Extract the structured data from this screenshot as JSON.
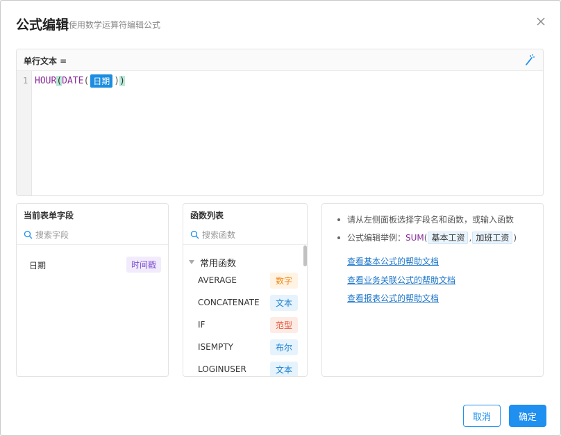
{
  "dialog": {
    "title": "公式编辑",
    "subtitle": "使用数学运算符编辑公式"
  },
  "editor": {
    "label": "单行文本 =",
    "line_number": "1",
    "tokens": {
      "fn1": "HOUR",
      "open1": "(",
      "fn2": "DATE",
      "open2": "(",
      "field": "日期",
      "close2": ")",
      "close1": ")"
    }
  },
  "fields_panel": {
    "title": "当前表单字段",
    "search_placeholder": "搜索字段",
    "items": [
      {
        "name": "日期",
        "type": "时间戳",
        "type_color": "#7b4fd3",
        "type_bg": "#f1ebfc"
      }
    ]
  },
  "functions_panel": {
    "title": "函数列表",
    "search_placeholder": "搜索函数",
    "group": "常用函数",
    "items": [
      {
        "name": "AVERAGE",
        "type": "数字",
        "color": "#f08a1c",
        "bg": "#fff3e4"
      },
      {
        "name": "CONCATENATE",
        "type": "文本",
        "color": "#1a7fd0",
        "bg": "#e6f3fc"
      },
      {
        "name": "IF",
        "type": "范型",
        "color": "#e8593a",
        "bg": "#fdebe6"
      },
      {
        "name": "ISEMPTY",
        "type": "布尔",
        "color": "#1a7fd0",
        "bg": "#e6f3fc"
      },
      {
        "name": "LOGINUSER",
        "type": "文本",
        "color": "#1a7fd0",
        "bg": "#e6f3fc"
      }
    ]
  },
  "help": {
    "tip1": "请从左侧面板选择字段名和函数，或输入函数",
    "tip2_prefix": "公式编辑举例：",
    "tip2_fn": "SUM",
    "tip2_open": "(",
    "tip2_arg1": "基本工资",
    "tip2_sep": ",",
    "tip2_arg2": "加班工资",
    "tip2_close": ")",
    "links": [
      "查看基本公式的帮助文档",
      "查看业务关联公式的帮助文档",
      "查看报表公式的帮助文档"
    ]
  },
  "footer": {
    "cancel": "取消",
    "ok": "确定"
  },
  "colors": {
    "primary": "#1f8ff0",
    "function": "#8b2b9a"
  }
}
